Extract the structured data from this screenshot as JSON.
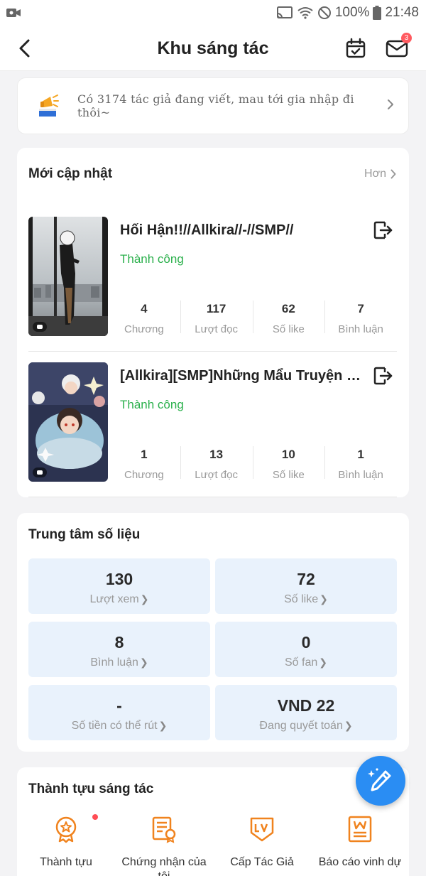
{
  "status_bar": {
    "battery": "100%",
    "time": "21:48"
  },
  "header": {
    "title": "Khu sáng tác",
    "mail_badge": "3"
  },
  "banner": {
    "text": "Có 3174 tác giả đang viết, mau tới gia nhập đi thôi~"
  },
  "updates": {
    "title": "Mới cập nhật",
    "more": "Hơn",
    "works": [
      {
        "title": "Hối Hận!!//Allkira//-//SMP//",
        "status": "Thành công",
        "stats": [
          {
            "value": "4",
            "label": "Chương"
          },
          {
            "value": "117",
            "label": "Lượt đọc"
          },
          {
            "value": "62",
            "label": "Số like"
          },
          {
            "value": "7",
            "label": "Bình luận"
          }
        ]
      },
      {
        "title": "[Allkira][SMP]Những Mẩu Truyện Ngắn",
        "status": "Thành công",
        "stats": [
          {
            "value": "1",
            "label": "Chương"
          },
          {
            "value": "13",
            "label": "Lượt đọc"
          },
          {
            "value": "10",
            "label": "Số like"
          },
          {
            "value": "1",
            "label": "Bình luận"
          }
        ]
      }
    ]
  },
  "data_center": {
    "title": "Trung tâm số liệu",
    "tiles": [
      {
        "value": "130",
        "label": "Lượt xem"
      },
      {
        "value": "72",
        "label": "Số like"
      },
      {
        "value": "8",
        "label": "Bình luận"
      },
      {
        "value": "0",
        "label": "Số fan"
      },
      {
        "value": "-",
        "label": "Số tiền có thể rút"
      },
      {
        "value": "VND 22",
        "label": "Đang quyết toán"
      }
    ]
  },
  "achievements": {
    "title": "Thành tựu sáng tác",
    "items": [
      {
        "label": "Thành tựu",
        "icon": "medal-icon"
      },
      {
        "label": "Chứng nhận của tôi",
        "icon": "certificate-icon"
      },
      {
        "label": "Cấp Tác Giả",
        "icon": "level-badge-icon"
      },
      {
        "label": "Báo cáo vinh dự",
        "icon": "honor-report-icon"
      }
    ]
  },
  "colors": {
    "success": "#2bb04c",
    "accent": "#2a8df3",
    "tile_bg": "#e9f2fc",
    "badge": "#ff5a5f",
    "achievement_icon": "#f0831e"
  }
}
